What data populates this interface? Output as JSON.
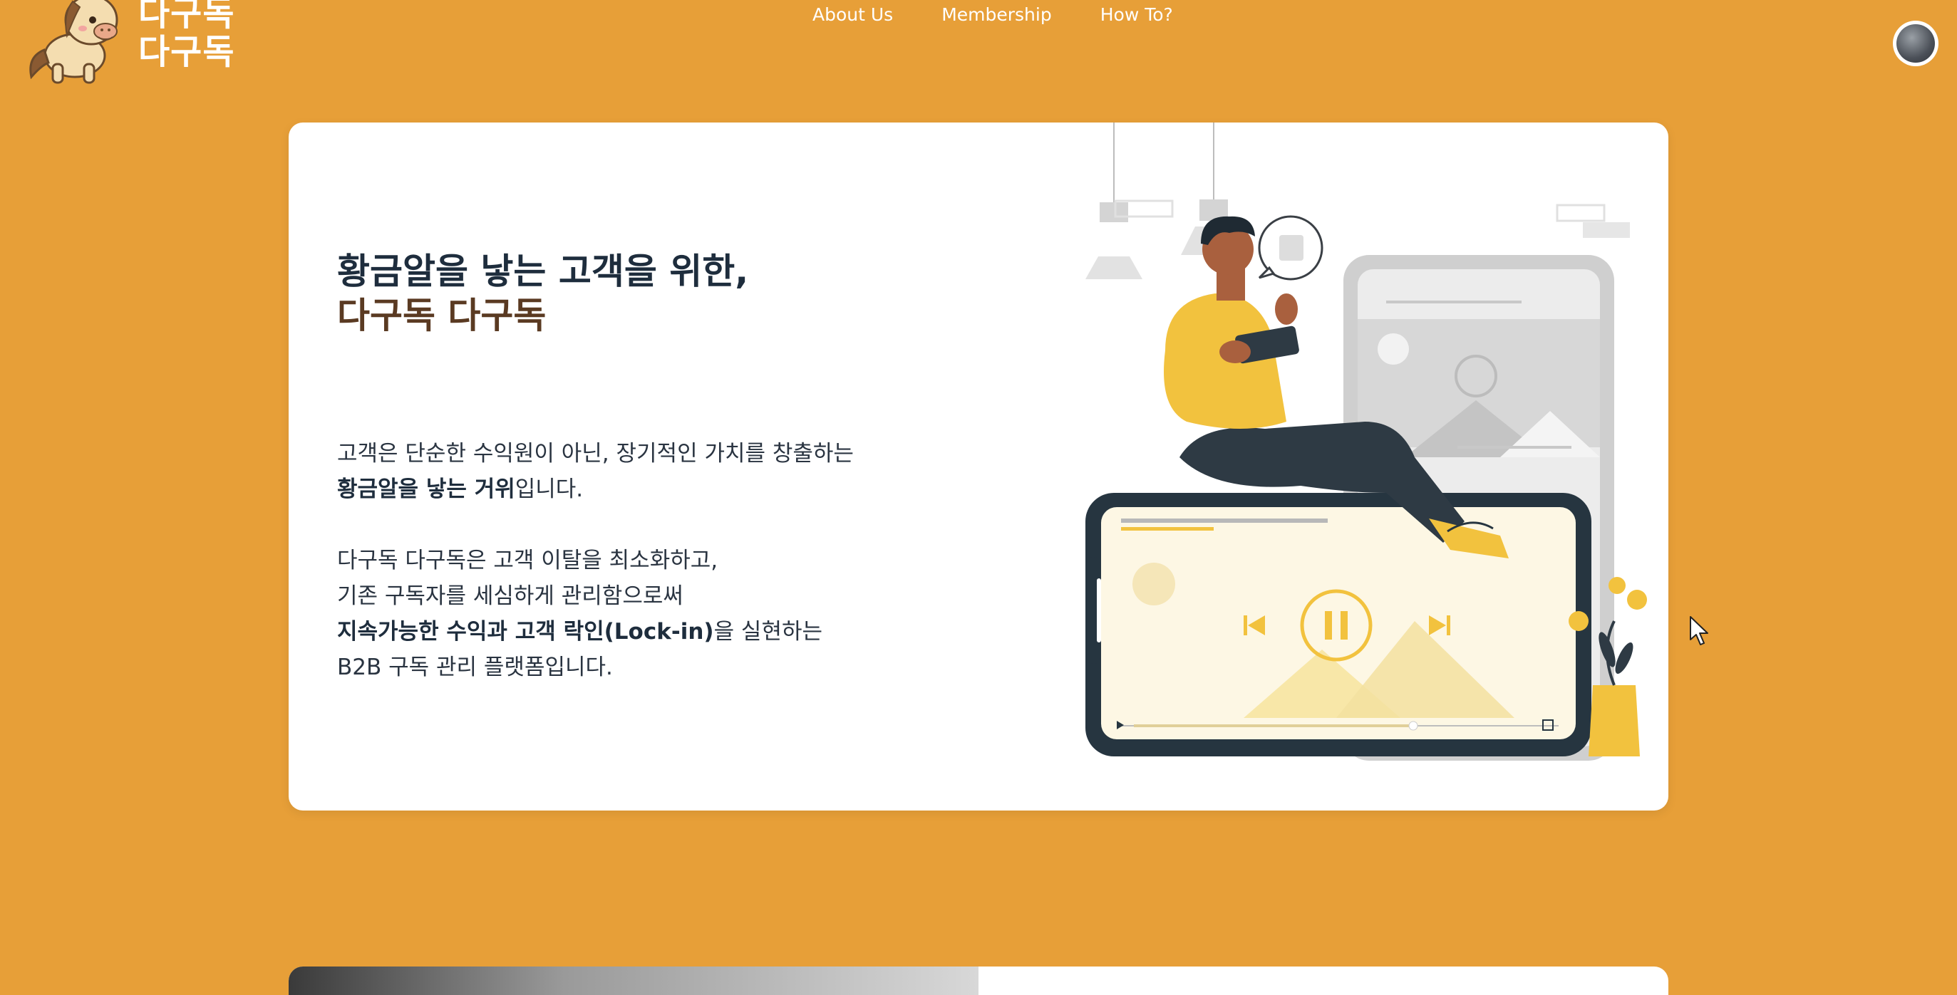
{
  "header": {
    "logo_line1": "다구독",
    "logo_line2": "다구독",
    "nav": [
      {
        "label": "About Us"
      },
      {
        "label": "Membership"
      },
      {
        "label": "How To?"
      }
    ]
  },
  "hero": {
    "title_line1": "황금알을 낳는 고객을 위한,",
    "title_line2": "다구독 다구독",
    "para1_line1": "고객은 단순한 수익원이 아닌, 장기적인 가치를 창출하는",
    "para1_bold": "황금알을 낳는 거위",
    "para1_tail": "입니다.",
    "para2_line1": "다구독 다구독은 고객 이탈을 최소화하고,",
    "para2_line2": "기존 구독자를 세심하게 관리함으로써",
    "para2_bold": "지속가능한 수익과 고객 락인(Lock-in)",
    "para2_tail": "을 실현하는",
    "para2_line4": "B2B 구독 관리 플랫폼입니다."
  },
  "colors": {
    "background": "#E79F38",
    "card": "#FFFFFF",
    "title_dark": "#1E2D3D",
    "title_brown": "#5A3A22",
    "accent_yellow": "#F2C23E"
  },
  "icons": {
    "logo": "horse-mascot-icon",
    "avatar": "user-avatar-icon",
    "cursor": "mouse-cursor-icon"
  }
}
